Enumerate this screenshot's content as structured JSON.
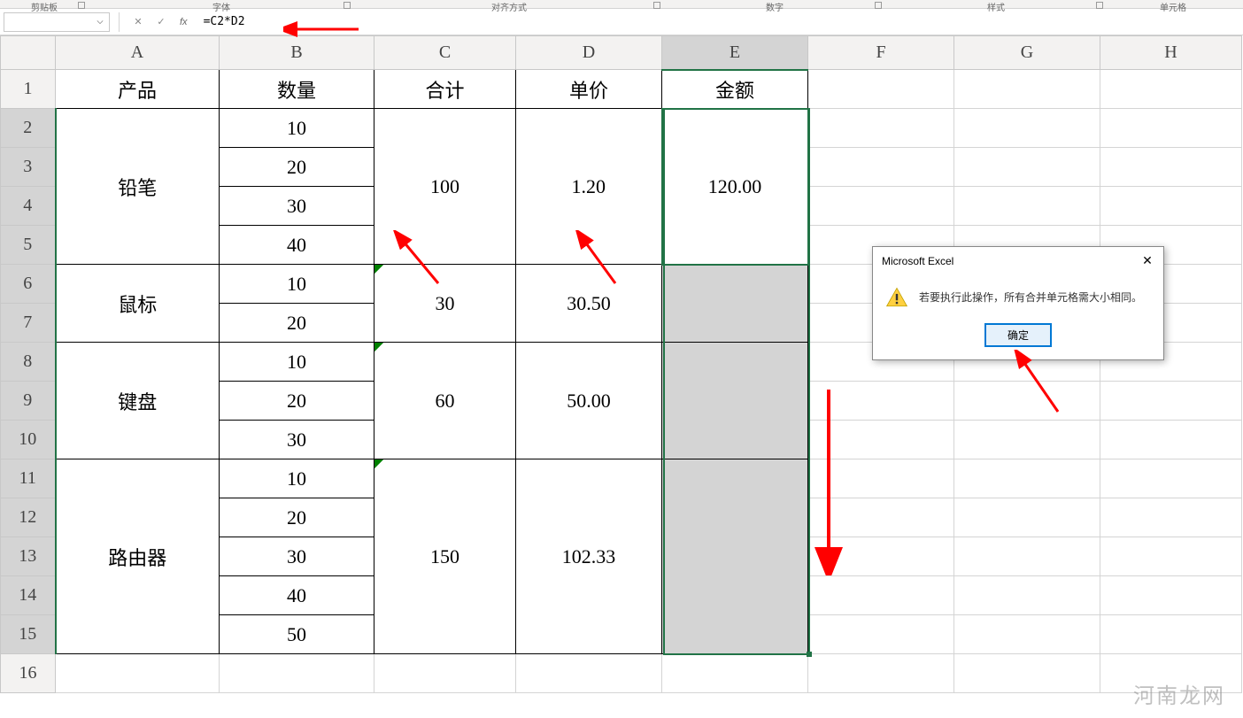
{
  "ribbon": {
    "sections": [
      "剪贴板",
      "字体",
      "对齐方式",
      "数字",
      "样式",
      "单元格"
    ]
  },
  "formula_bar": {
    "name_box": "",
    "formula": "=C2*D2"
  },
  "columns": [
    "A",
    "B",
    "C",
    "D",
    "E",
    "F",
    "G",
    "H"
  ],
  "rows": [
    "1",
    "2",
    "3",
    "4",
    "5",
    "6",
    "7",
    "8",
    "9",
    "10",
    "11",
    "12",
    "13",
    "14",
    "15",
    "16"
  ],
  "headers": {
    "a": "产品",
    "b": "数量",
    "c": "合计",
    "d": "单价",
    "e": "金额"
  },
  "products": [
    {
      "name": "铅笔",
      "qty": [
        "10",
        "20",
        "30",
        "40"
      ],
      "sum": "100",
      "price": "1.20",
      "amount": "120.00"
    },
    {
      "name": "鼠标",
      "qty": [
        "10",
        "20"
      ],
      "sum": "30",
      "price": "30.50",
      "amount": ""
    },
    {
      "name": "键盘",
      "qty": [
        "10",
        "20",
        "30"
      ],
      "sum": "60",
      "price": "50.00",
      "amount": ""
    },
    {
      "name": "路由器",
      "qty": [
        "10",
        "20",
        "30",
        "40",
        "50"
      ],
      "sum": "150",
      "price": "102.33",
      "amount": ""
    }
  ],
  "dialog": {
    "title": "Microsoft Excel",
    "message": "若要执行此操作，所有合并单元格需大小相同。",
    "ok": "确定"
  },
  "watermark": "河南龙网",
  "chart_data": {
    "type": "table",
    "columns": [
      "产品",
      "数量",
      "合计",
      "单价",
      "金额"
    ],
    "rows": [
      [
        "铅笔",
        10,
        100,
        1.2,
        120.0
      ],
      [
        "铅笔",
        20,
        100,
        1.2,
        120.0
      ],
      [
        "铅笔",
        30,
        100,
        1.2,
        120.0
      ],
      [
        "铅笔",
        40,
        100,
        1.2,
        120.0
      ],
      [
        "鼠标",
        10,
        30,
        30.5,
        null
      ],
      [
        "鼠标",
        20,
        30,
        30.5,
        null
      ],
      [
        "键盘",
        10,
        60,
        50.0,
        null
      ],
      [
        "键盘",
        20,
        60,
        50.0,
        null
      ],
      [
        "键盘",
        30,
        60,
        50.0,
        null
      ],
      [
        "路由器",
        10,
        150,
        102.33,
        null
      ],
      [
        "路由器",
        20,
        150,
        102.33,
        null
      ],
      [
        "路由器",
        30,
        150,
        102.33,
        null
      ],
      [
        "路由器",
        40,
        150,
        102.33,
        null
      ],
      [
        "路由器",
        50,
        150,
        102.33,
        null
      ]
    ]
  }
}
